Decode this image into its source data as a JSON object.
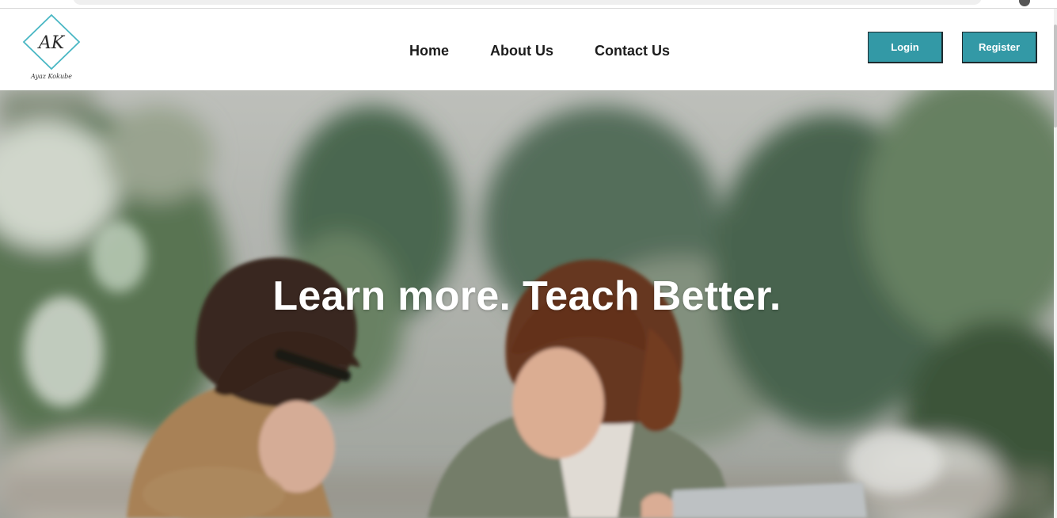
{
  "brand": {
    "logo_monogram": "AK",
    "logo_signature": "Ayaz Kokube",
    "accent_color": "#3399a6"
  },
  "nav": {
    "items": [
      {
        "label": "Home"
      },
      {
        "label": "About Us"
      },
      {
        "label": "Contact Us"
      }
    ]
  },
  "auth": {
    "login_label": "Login",
    "register_label": "Register"
  },
  "hero": {
    "headline": "Learn more. Teach Better.",
    "image_subject": "two women smiling and looking at a laptop among plants"
  }
}
